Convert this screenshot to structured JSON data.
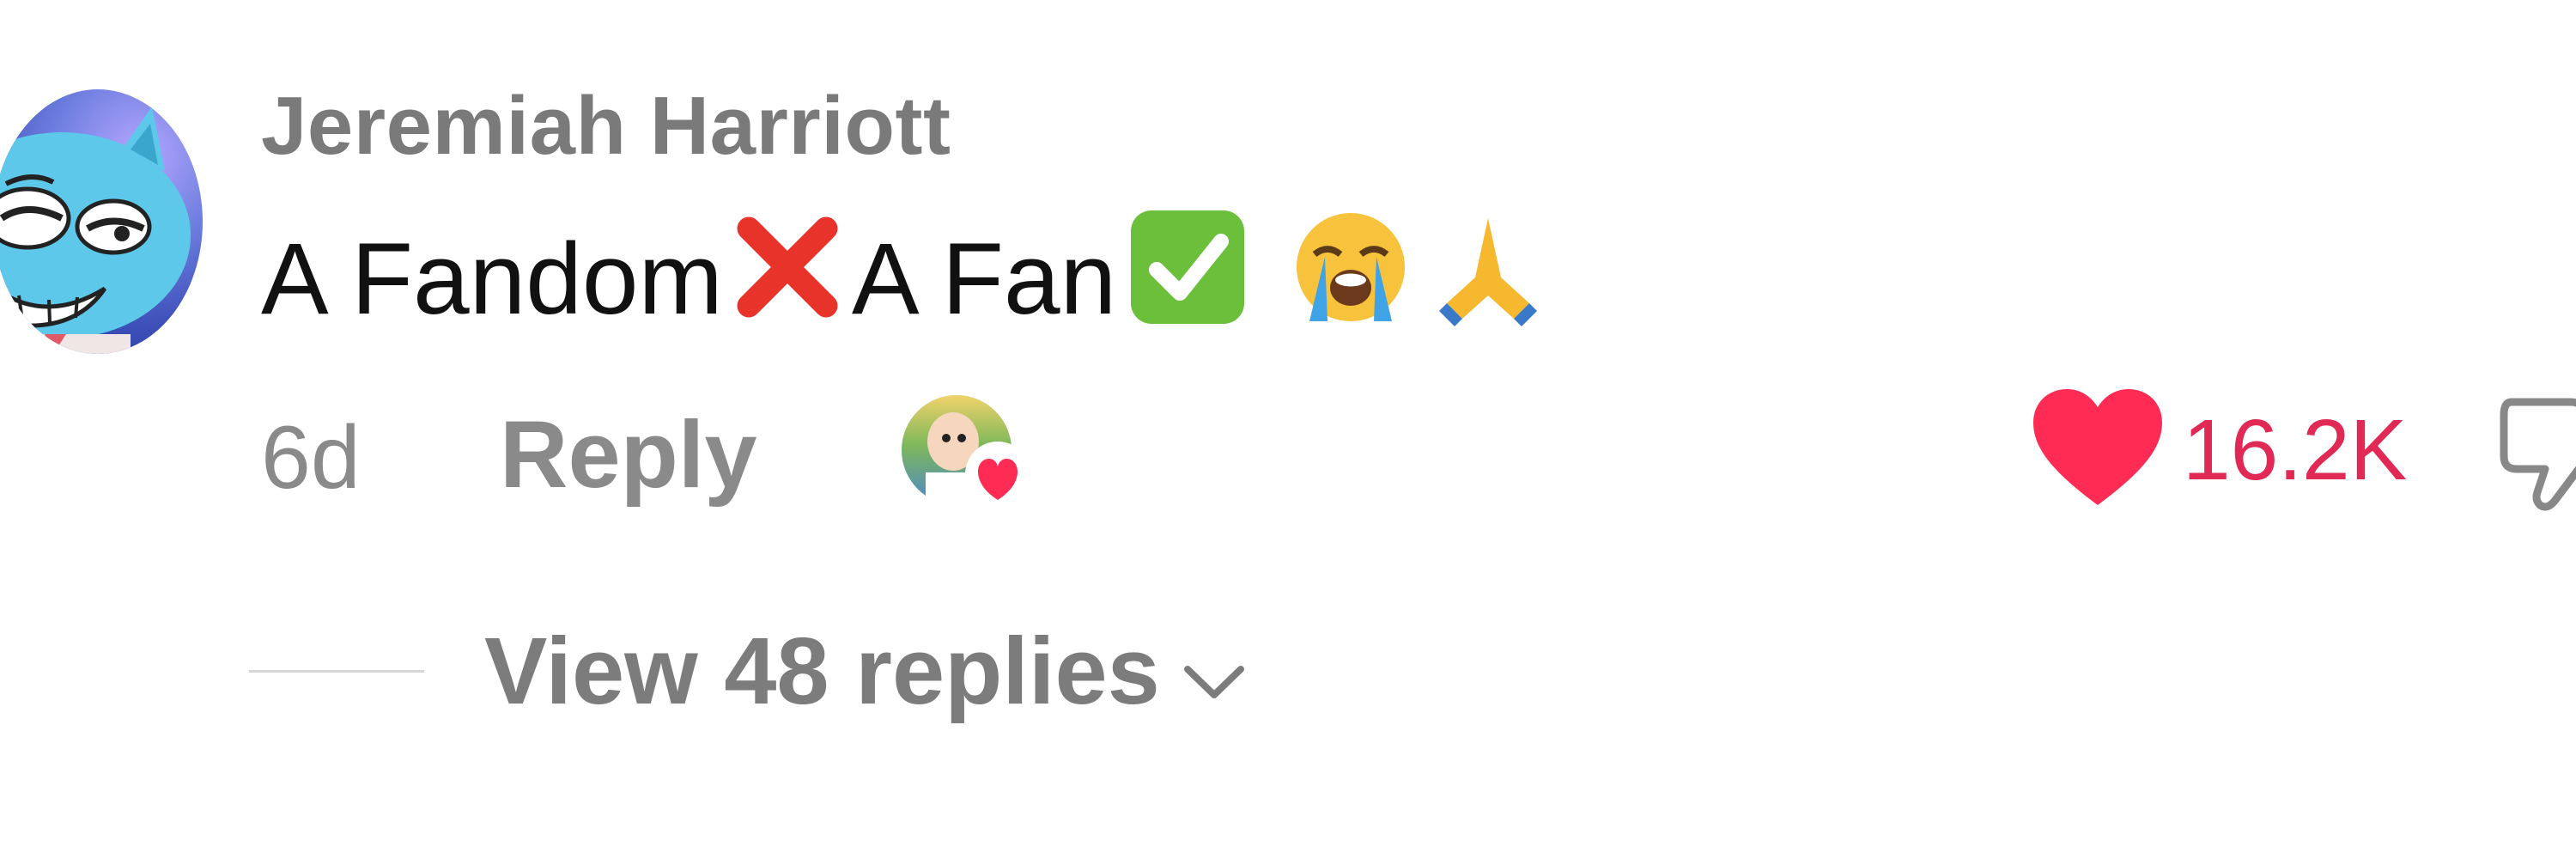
{
  "comment": {
    "username": "Jeremiah Harriott",
    "text_part1": "A Fandom",
    "text_part2": " A Fan",
    "time": "6d",
    "reply_label": "Reply",
    "like_count": "16.2K",
    "view_replies_label": "View 48 replies"
  },
  "icons": {
    "cross_mark": "cross-mark-emoji",
    "check_mark": "check-mark-emoji",
    "crying_face": "loudly-crying-face-emoji",
    "pray": "folded-hands-emoji",
    "like": "heart-icon",
    "dislike": "thumbs-down-icon",
    "chevron": "chevron-down-icon"
  },
  "colors": {
    "like_red": "#e02a55",
    "muted_text": "#8a8a8a",
    "body_text": "#111111"
  }
}
